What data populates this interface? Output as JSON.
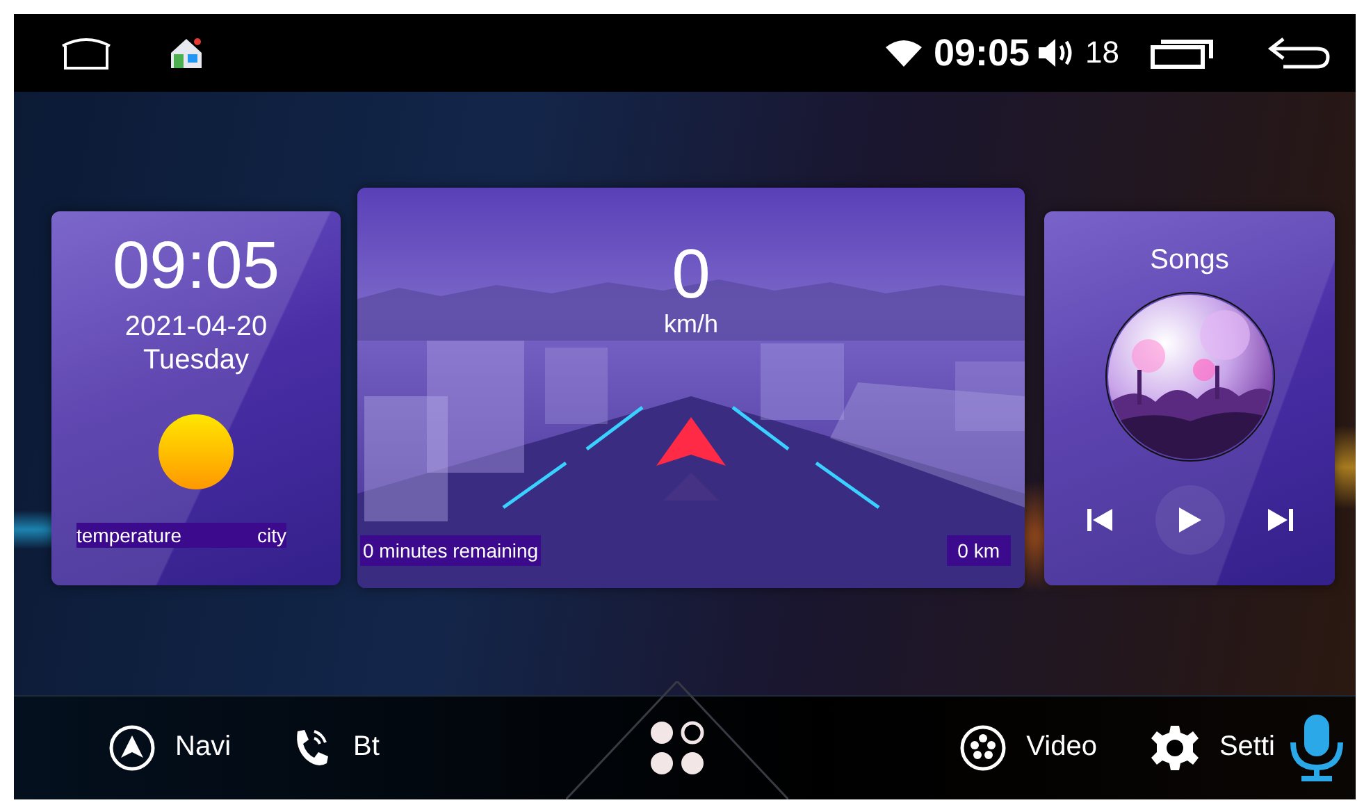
{
  "status_bar": {
    "time": "09:05",
    "volume": "18"
  },
  "weather": {
    "time": "09:05",
    "date": "2021-04-20",
    "weekday": "Tuesday",
    "temperature_label": "temperature",
    "city_label": "city"
  },
  "navigation": {
    "speed": "0",
    "unit": "km/h",
    "remaining": "0 minutes remaining",
    "distance": "0 km"
  },
  "music": {
    "title": "Songs"
  },
  "dock": {
    "items": [
      {
        "kind": "navi",
        "label": "Navi"
      },
      {
        "kind": "bt",
        "label": "Bt"
      },
      {
        "kind": "apps"
      },
      {
        "kind": "video",
        "label": "Video"
      },
      {
        "kind": "settings",
        "label": "Setti"
      }
    ]
  }
}
